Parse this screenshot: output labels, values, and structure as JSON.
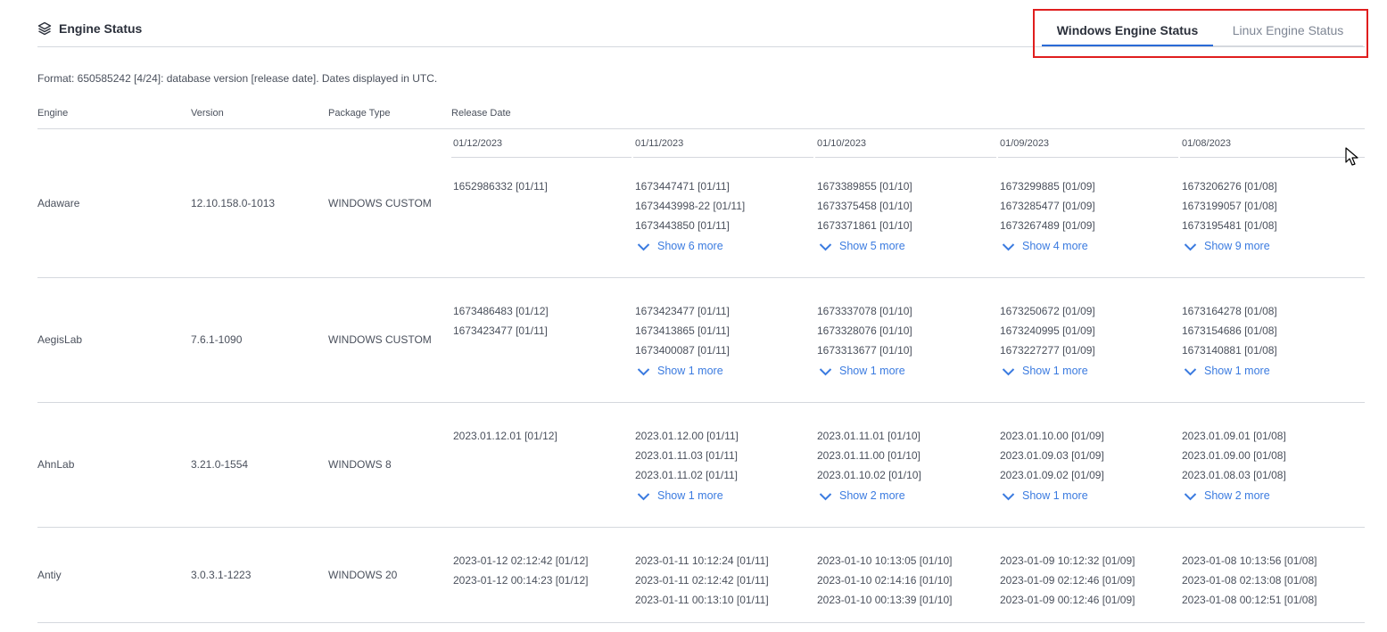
{
  "header": {
    "title": "Engine Status",
    "icon": "layers-icon"
  },
  "tabs": [
    {
      "label": "Windows Engine Status",
      "active": true
    },
    {
      "label": "Linux Engine Status",
      "active": false
    }
  ],
  "format_note": "Format: 650585242 [4/24]: database version [release date]. Dates displayed in UTC.",
  "columns": {
    "engine": "Engine",
    "version": "Version",
    "package_type": "Package Type",
    "release_date": "Release Date"
  },
  "dates": [
    "01/12/2023",
    "01/11/2023",
    "01/10/2023",
    "01/09/2023",
    "01/08/2023"
  ],
  "rows": [
    {
      "engine": "Adaware",
      "version": "12.10.158.0-1013",
      "package": "WINDOWS CUSTOM",
      "releases": [
        {
          "items": [
            "1652986332 [01/11]"
          ],
          "more": ""
        },
        {
          "items": [
            "1673447471 [01/11]",
            "1673443998-22 [01/11]",
            "1673443850 [01/11]"
          ],
          "more": "Show 6 more"
        },
        {
          "items": [
            "1673389855 [01/10]",
            "1673375458 [01/10]",
            "1673371861 [01/10]"
          ],
          "more": "Show 5 more"
        },
        {
          "items": [
            "1673299885 [01/09]",
            "1673285477 [01/09]",
            "1673267489 [01/09]"
          ],
          "more": "Show 4 more"
        },
        {
          "items": [
            "1673206276 [01/08]",
            "1673199057 [01/08]",
            "1673195481 [01/08]"
          ],
          "more": "Show 9 more"
        }
      ]
    },
    {
      "engine": "AegisLab",
      "version": "7.6.1-1090",
      "package": "WINDOWS CUSTOM",
      "releases": [
        {
          "items": [
            "1673486483 [01/12]",
            "1673423477 [01/11]"
          ],
          "more": ""
        },
        {
          "items": [
            "1673423477 [01/11]",
            "1673413865 [01/11]",
            "1673400087 [01/11]"
          ],
          "more": "Show 1 more"
        },
        {
          "items": [
            "1673337078 [01/10]",
            "1673328076 [01/10]",
            "1673313677 [01/10]"
          ],
          "more": "Show 1 more"
        },
        {
          "items": [
            "1673250672 [01/09]",
            "1673240995 [01/09]",
            "1673227277 [01/09]"
          ],
          "more": "Show 1 more"
        },
        {
          "items": [
            "1673164278 [01/08]",
            "1673154686 [01/08]",
            "1673140881 [01/08]"
          ],
          "more": "Show 1 more"
        }
      ]
    },
    {
      "engine": "AhnLab",
      "version": "3.21.0-1554",
      "package": "WINDOWS 8",
      "releases": [
        {
          "items": [
            "2023.01.12.01 [01/12]"
          ],
          "more": ""
        },
        {
          "items": [
            "2023.01.12.00 [01/11]",
            "2023.01.11.03 [01/11]",
            "2023.01.11.02 [01/11]"
          ],
          "more": "Show 1 more"
        },
        {
          "items": [
            "2023.01.11.01 [01/10]",
            "2023.01.11.00 [01/10]",
            "2023.01.10.02 [01/10]"
          ],
          "more": "Show 2 more"
        },
        {
          "items": [
            "2023.01.10.00 [01/09]",
            "2023.01.09.03 [01/09]",
            "2023.01.09.02 [01/09]"
          ],
          "more": "Show 1 more"
        },
        {
          "items": [
            "2023.01.09.01 [01/08]",
            "2023.01.09.00 [01/08]",
            "2023.01.08.03 [01/08]"
          ],
          "more": "Show 2 more"
        }
      ]
    },
    {
      "engine": "Antiy",
      "version": "3.0.3.1-1223",
      "package": "WINDOWS 20",
      "releases": [
        {
          "items": [
            "2023-01-12 02:12:42 [01/12]",
            "2023-01-12 00:14:23 [01/12]"
          ],
          "more": ""
        },
        {
          "items": [
            "2023-01-11 10:12:24 [01/11]",
            "2023-01-11 02:12:42 [01/11]",
            "2023-01-11 00:13:10 [01/11]"
          ],
          "more": ""
        },
        {
          "items": [
            "2023-01-10 10:13:05 [01/10]",
            "2023-01-10 02:14:16 [01/10]",
            "2023-01-10 00:13:39 [01/10]"
          ],
          "more": ""
        },
        {
          "items": [
            "2023-01-09 10:12:32 [01/09]",
            "2023-01-09 02:12:46 [01/09]",
            "2023-01-09 00:12:46 [01/09]"
          ],
          "more": ""
        },
        {
          "items": [
            "2023-01-08 10:13:56 [01/08]",
            "2023-01-08 02:13:08 [01/08]",
            "2023-01-08 00:12:51 [01/08]"
          ],
          "more": ""
        }
      ]
    }
  ]
}
